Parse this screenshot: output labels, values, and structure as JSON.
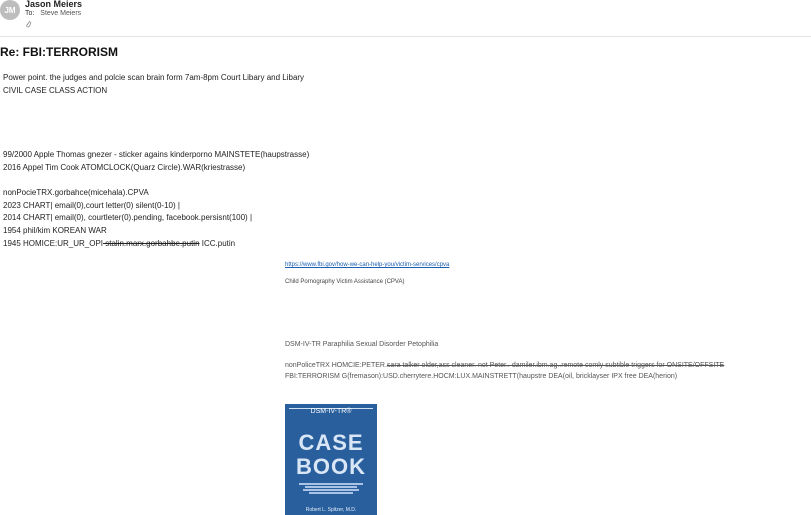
{
  "header": {
    "avatar_initials": "JM",
    "sender": "Jason Meiers",
    "to_label": "To:",
    "recipient": "Steve Meiers"
  },
  "subject": "Re: FBI:TERRORISM",
  "body": {
    "intro1": "Power point. the judges and polcie scan brain form 7am-8pm Court Libary and Libary",
    "intro2": "CIVIL CASE CLASS ACTION",
    "l1": "99/2000 Apple Thomas gnezer - sticker agains kinderporno   MAINSTETE(haupstrasse)",
    "l2": "2016 Appel Tim Cook   ATOMCLOCK(Quarz Circle).WAR(kriestrasse)",
    "l3": "nonPocieTRX.gorbahce(micehala).CPVA",
    "l4": "2023 CHART|    email(0),court letter(0)    silent(0-10)   |",
    "l5": "2014 CHART|    email(0), courtleter(0).pending,  facebook.persisnt(100) |",
    "l6": "1954 phil/kim KOREAN WAR",
    "l7_a": "1945 HOMICE:UR_UR_OPI",
    "l7_b": " stalin.marx.gorbahbe.putin",
    "l7_c": " ICC.putin"
  },
  "right": {
    "link": "https://www.fbi.gov/how-we-can-help-you/victim-services/cpva",
    "cpva": "Child Pornography Victim Assistance (CPVA)",
    "dsm": "DSM-IV-TR Paraphilia Sexual Disorder Petophilia",
    "np_a": "nonPoliceTRX HOMCIE:PETER.",
    "np_b": "sara talker older,ass cleaner. not Peter.. damiler.ibm.ag..remote comly subtible triggers for ONSITE/OFFSITE",
    "fbi": "FBI:TERRORISM   G(fremason):USD.cherrytere.HOCM:LUX.MAINSTRETT(haupstre DEA(oil, bricklayser IPX free DEA(herion)"
  },
  "book": {
    "series": "DSM-IV-TR®",
    "title1": "CASE",
    "title2": "BOOK",
    "author": "Robert L. Spitzer, M.D."
  },
  "colors": {
    "link": "#1a5fb4",
    "book_cover": "#2a5f9e",
    "avatar": "#bdbdbd"
  }
}
